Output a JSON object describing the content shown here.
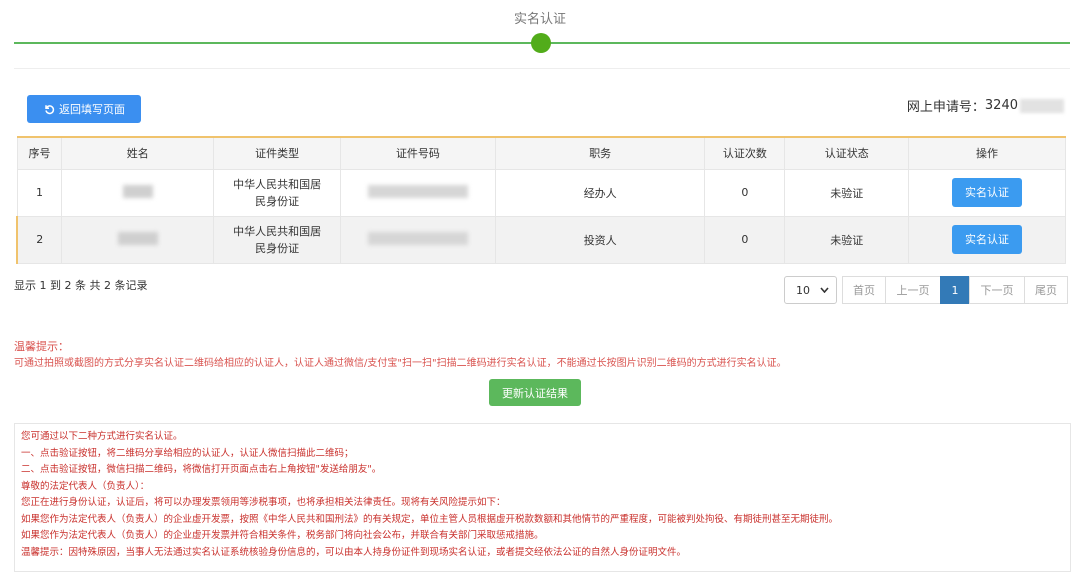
{
  "step": {
    "title": "实名认证"
  },
  "toolbar": {
    "back_label": "返回填写页面",
    "apply_label": "网上申请号：",
    "apply_prefix": "3240"
  },
  "table": {
    "headers": [
      "序号",
      "姓名",
      "证件类型",
      "证件号码",
      "职务",
      "认证次数",
      "认证状态",
      "操作"
    ],
    "rows": [
      {
        "no": "1",
        "doc_type": "中华人民共和国居民身份证",
        "role": "经办人",
        "count": "0",
        "status": "未验证",
        "action": "实名认证"
      },
      {
        "no": "2",
        "doc_type": "中华人民共和国居民身份证",
        "role": "投资人",
        "count": "0",
        "status": "未验证",
        "action": "实名认证"
      }
    ]
  },
  "summary": "显示 1 到 2 条 共 2 条记录",
  "pagination": {
    "page_size": "10",
    "items": [
      "首页",
      "上一页",
      "1",
      "下一页",
      "尾页"
    ],
    "active_page": "1"
  },
  "tip": {
    "title": "温馨提示：",
    "text": "可通过拍照或截图的方式分享实名认证二维码给相应的认证人，认证人通过微信/支付宝\"扫一扫\"扫描二维码进行实名认证，不能通过长按图片识别二维码的方式进行实名认证。",
    "refresh_label": "更新认证结果"
  },
  "notice": {
    "lines": [
      "您可通过以下二种方式进行实名认证。",
      "一、点击验证按钮，将二维码分享给相应的认证人，认证人微信扫描此二维码；",
      "二、点击验证按钮，微信扫描二维码，将微信打开页面点击右上角按钮\"发送给朋友\"。",
      "尊敬的法定代表人（负责人）：",
      "您正在进行身份认证，认证后，将可以办理发票领用等涉税事项，也将承担相关法律责任。现将有关风险提示如下：",
      "如果您作为法定代表人（负责人）的企业虚开发票，按照《中华人民共和国刑法》的有关规定，单位主管人员根据虚开税款数额和其他情节的严重程度，可能被判处拘役、有期徒刑甚至无期徒刑。",
      "如果您作为法定代表人（负责人）的企业虚开发票并符合相关条件，税务部门将向社会公布，并联合有关部门采取惩戒措施。",
      "温馨提示：因特殊原因，当事人无法通过实名认证系统核验身份信息的，可以由本人持身份证件到现场实名认证，或者提交经依法公证的自然人身份证明文件。"
    ]
  }
}
